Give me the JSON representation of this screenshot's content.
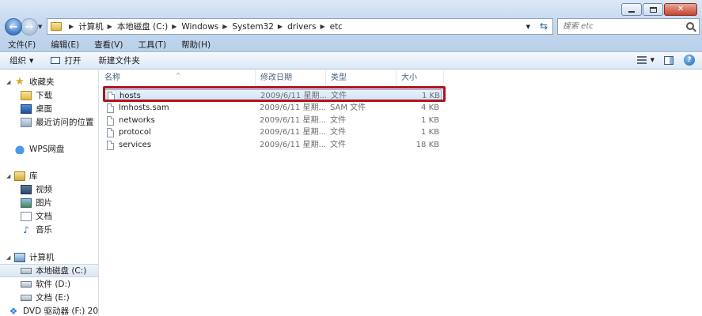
{
  "address": {
    "crumbs": [
      "计算机",
      "本地磁盘 (C:)",
      "Windows",
      "System32",
      "drivers",
      "etc"
    ]
  },
  "search": {
    "placeholder": "搜索 etc"
  },
  "menubar": {
    "file": "文件(F)",
    "edit": "编辑(E)",
    "view": "查看(V)",
    "tools": "工具(T)",
    "help": "帮助(H)"
  },
  "toolbar": {
    "organize": "组织",
    "open": "打开",
    "new_folder": "新建文件夹"
  },
  "navpane": {
    "favorites": "收藏夹",
    "downloads": "下载",
    "desktop": "桌面",
    "recent": "最近访问的位置",
    "wps": "WPS网盘",
    "libraries": "库",
    "videos": "视频",
    "pictures": "图片",
    "documents": "文档",
    "music": "音乐",
    "computer": "计算机",
    "drive_c": "本地磁盘 (C:)",
    "drive_d": "软件 (D:)",
    "drive_e": "文档 (E:)",
    "drive_f": "DVD 驱动器 (F:) 20"
  },
  "columns": {
    "name": "名称",
    "date": "修改日期",
    "type": "类型",
    "size": "大小"
  },
  "files": [
    {
      "name": "hosts",
      "date": "2009/6/11 星期...",
      "type": "文件",
      "size": "1 KB"
    },
    {
      "name": "lmhosts.sam",
      "date": "2009/6/11 星期...",
      "type": "SAM 文件",
      "size": "4 KB"
    },
    {
      "name": "networks",
      "date": "2009/6/11 星期...",
      "type": "文件",
      "size": "1 KB"
    },
    {
      "name": "protocol",
      "date": "2009/6/11 星期...",
      "type": "文件",
      "size": "1 KB"
    },
    {
      "name": "services",
      "date": "2009/6/11 星期...",
      "type": "文件",
      "size": "18 KB"
    }
  ],
  "colors": {
    "highlight_box": "#b0141d",
    "selection": "#cfe2f7"
  }
}
